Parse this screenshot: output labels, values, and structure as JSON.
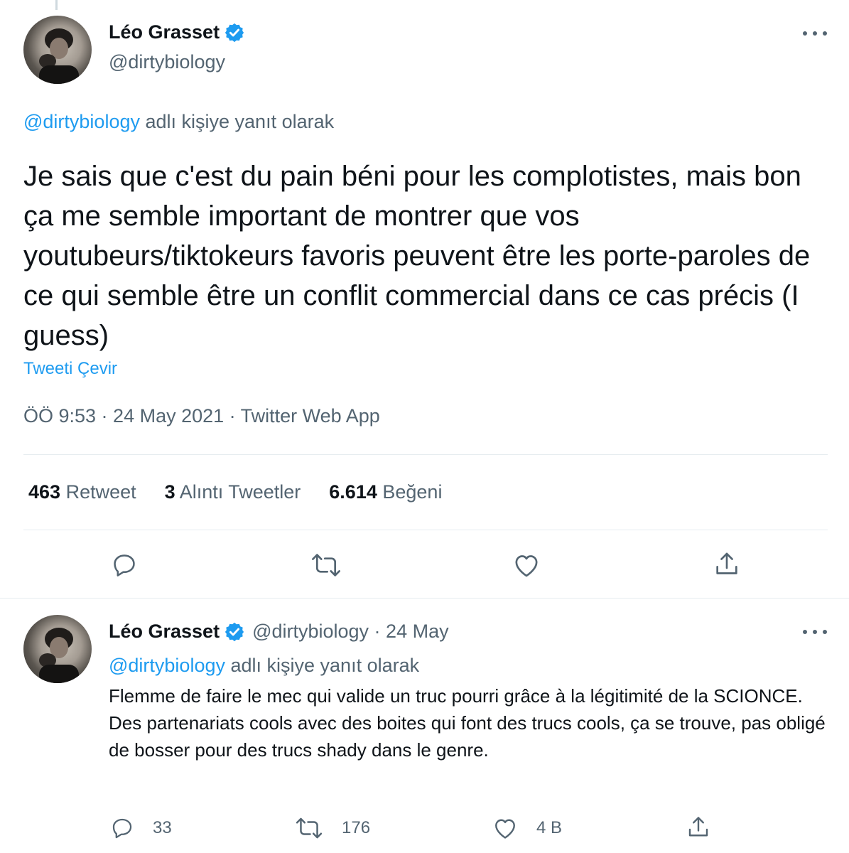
{
  "main_tweet": {
    "author_name": "Léo Grasset",
    "handle": "@dirtybiology",
    "reply_to_handle": "@dirtybiology",
    "reply_to_suffix": " adlı kişiye yanıt olarak",
    "text": "Je sais que c'est du pain béni pour les complotistes, mais bon ça me semble important de montrer que vos youtubeurs/tiktokeurs favoris peuvent être les porte-paroles de ce qui semble être un conflit commercial dans ce cas précis (I guess)",
    "translate_label": "Tweeti Çevir",
    "timestamp": "ÖÖ 9:53 · 24 May 2021 · Twitter Web App",
    "stats": {
      "retweets": "463",
      "retweets_label": "Retweet",
      "quotes": "3",
      "quotes_label": "Alıntı Tweetler",
      "likes": "6.614",
      "likes_label": "Beğeni"
    },
    "actions": {
      "reply_icon": "reply-icon",
      "retweet_icon": "retweet-icon",
      "like_icon": "heart-icon",
      "share_icon": "share-icon"
    }
  },
  "reply_tweet": {
    "author_name": "Léo Grasset",
    "handle_date": "@dirtybiology · 24 May",
    "reply_to_handle": "@dirtybiology",
    "reply_to_suffix": " adlı kişiye yanıt olarak",
    "text_line1": "Flemme de faire le mec qui valide un truc pourri grâce à la légitimité de la SCIONCE.",
    "text_line2": "Des partenariats cools avec des boites qui font des trucs cools, ça se trouve, pas obligé de bosser pour des trucs shady dans le genre.",
    "reply_count": "33",
    "retweet_count": "176",
    "like_count": "4 B"
  },
  "colors": {
    "accent": "#1d9bf0",
    "text": "#0f1419",
    "secondary": "#536471",
    "divider": "#e6ecf0"
  }
}
